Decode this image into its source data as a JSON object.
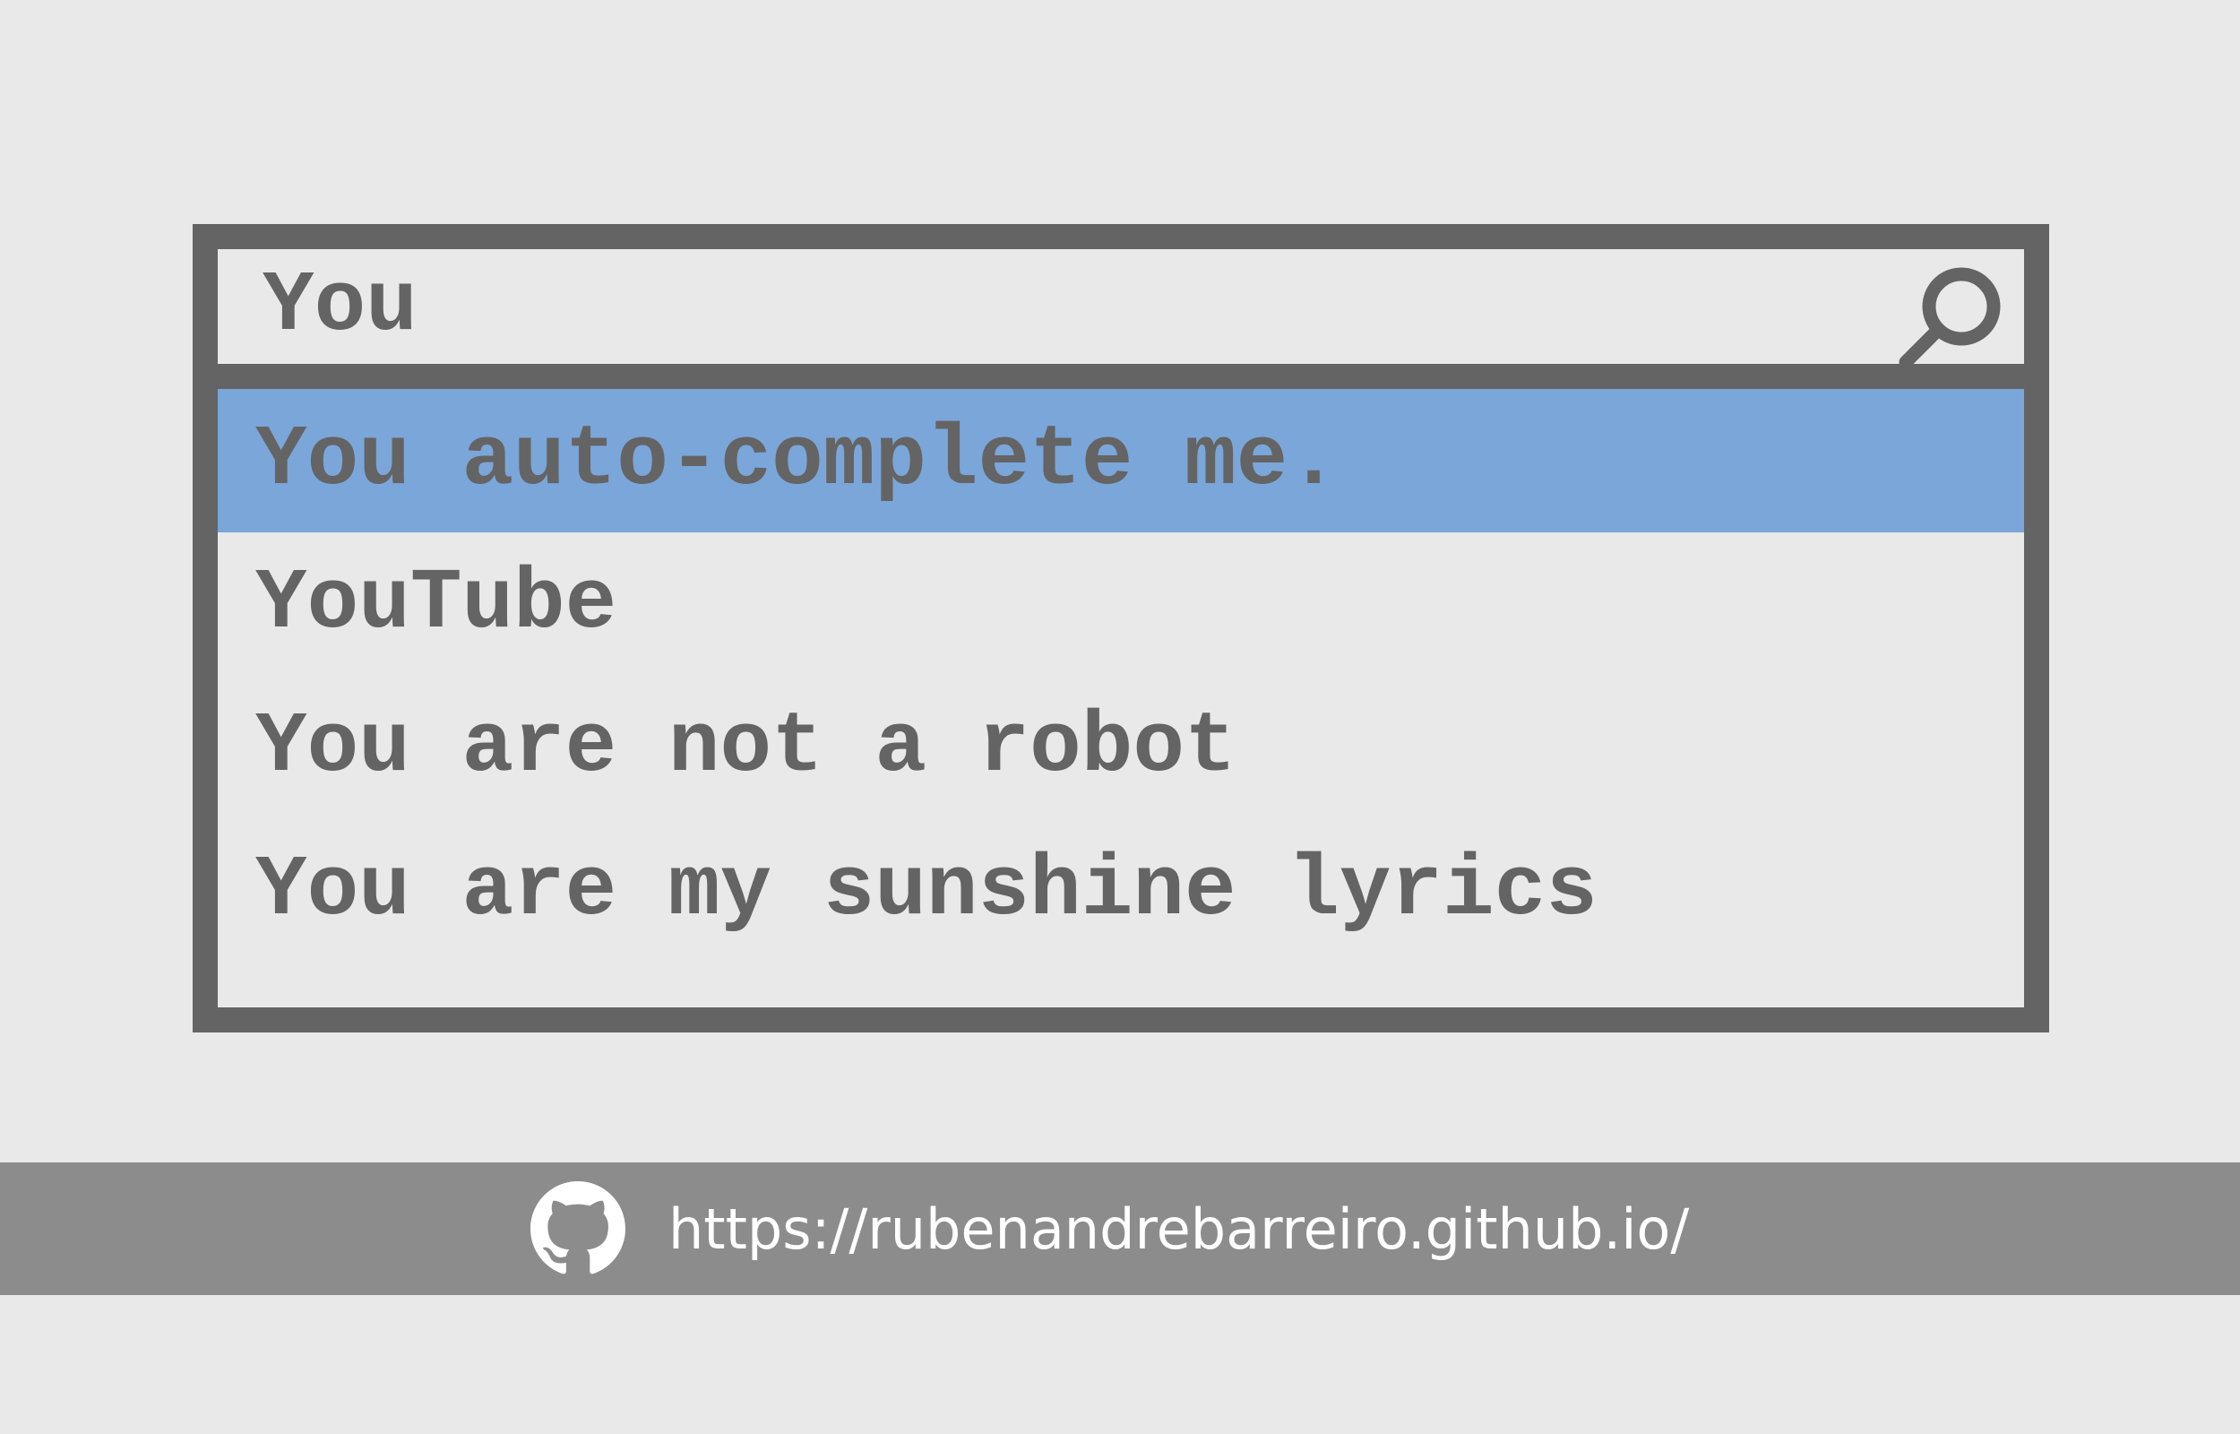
{
  "search": {
    "value": "You",
    "icon": "search-icon"
  },
  "suggestions": [
    {
      "label": "You auto-complete me.",
      "selected": true
    },
    {
      "label": "YouTube",
      "selected": false
    },
    {
      "label": "You are not a robot",
      "selected": false
    },
    {
      "label": "You are my sunshine lyrics",
      "selected": false
    }
  ],
  "footer": {
    "icon": "github-icon",
    "link_text": "https://rubenandrebarreiro.github.io/"
  },
  "colors": {
    "background": "#e9e9e9",
    "border": "#646464",
    "text": "#646464",
    "highlight": "#7ba6d9",
    "footer_background": "#8c8c8c",
    "footer_text": "#ffffff"
  }
}
